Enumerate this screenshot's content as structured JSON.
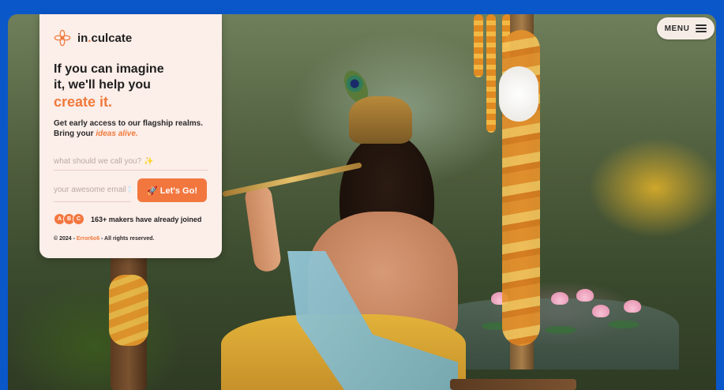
{
  "brand": {
    "name_prefix": "in",
    "name_dot": ".",
    "name_suffix": "culcate",
    "accent_color": "#f07a3c",
    "logo_icon": "flower-icon"
  },
  "menu": {
    "label": "MENU",
    "icon": "hamburger-icon"
  },
  "hero": {
    "headline_line1": "If you can imagine",
    "headline_line2": "it, we'll help you",
    "headline_accent": "create it.",
    "sub_line1": "Get early access to our flagship realms.",
    "sub_prefix": "Bring your ",
    "sub_emphasis": "ideas alive."
  },
  "form": {
    "name_placeholder": "what should we call you? ✨",
    "email_placeholder": "your awesome email 📧",
    "submit_label": "🚀 Let's Go!"
  },
  "social_proof": {
    "avatars": [
      "A",
      "B",
      "C"
    ],
    "text": "163+ makers have already joined"
  },
  "footer": {
    "prefix": "© 2024 - ",
    "brand": "Error6o6",
    "suffix": " - All rights reserved."
  },
  "colors": {
    "frame_blue": "#0a57c9",
    "card_bg": "#fceee9",
    "button_orange": "#f2773f"
  }
}
